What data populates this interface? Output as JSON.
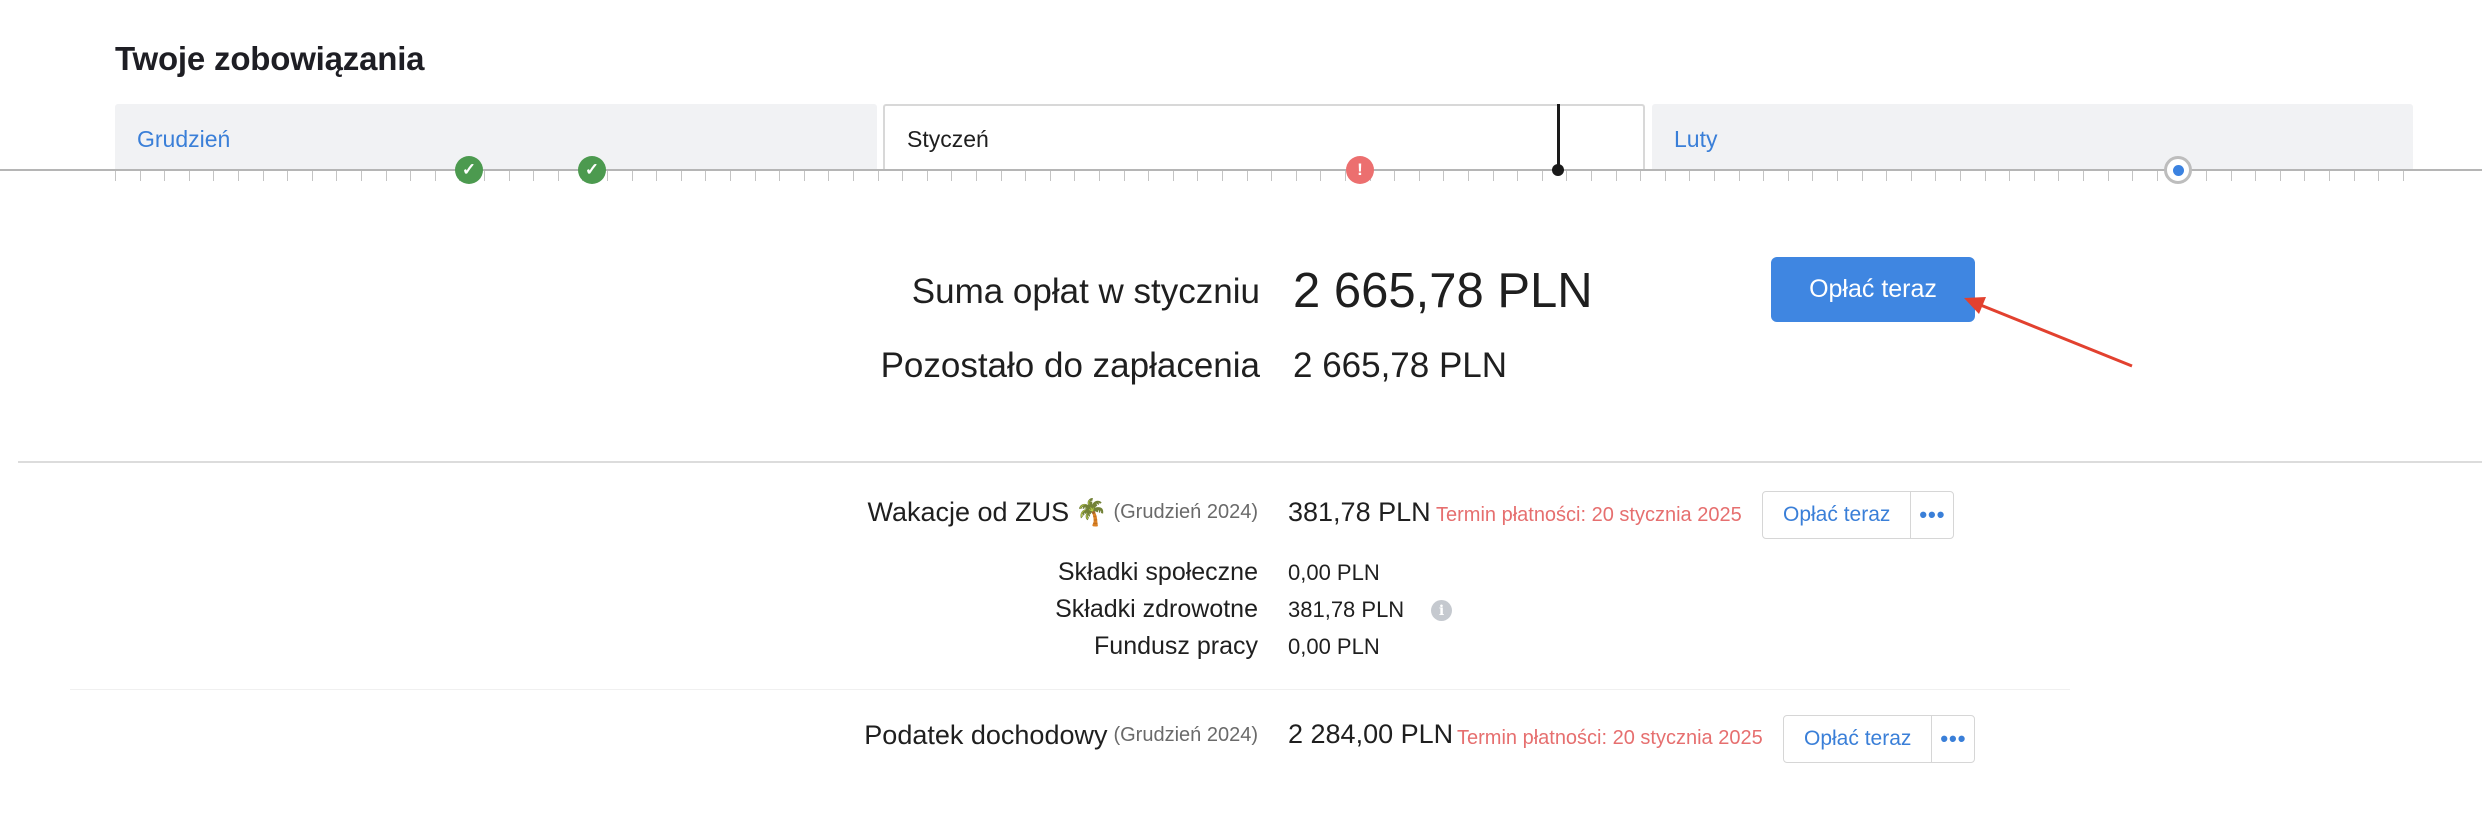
{
  "page": {
    "title": "Twoje zobowiązania"
  },
  "timeline": {
    "months": [
      {
        "label": "Grudzień",
        "active": false
      },
      {
        "label": "Styczeń",
        "active": true
      },
      {
        "label": "Luty",
        "active": false
      }
    ],
    "markers": [
      {
        "status": "paid",
        "icon": "check-icon",
        "glyph": "✓"
      },
      {
        "status": "paid",
        "icon": "check-icon",
        "glyph": "✓"
      },
      {
        "status": "overdue",
        "icon": "exclamation-icon",
        "glyph": "!"
      },
      {
        "status": "upcoming",
        "icon": "dot-icon",
        "glyph": ""
      }
    ],
    "colors": {
      "paid": "#4c9a4f",
      "overdue": "#ec6f6f",
      "upcoming": "#3b82e0",
      "accent": "#3a7fd8"
    }
  },
  "summary": {
    "sum_label": "Suma opłat w styczniu",
    "sum_value": "2 665,78 PLN",
    "remaining_label": "Pozostało do zapłacenia",
    "remaining_value": "2 665,78 PLN",
    "pay_button": "Opłać teraz"
  },
  "obligations": [
    {
      "title": "Wakacje od ZUS",
      "icon": "palm-tree-icon",
      "period": "(Grudzień 2024)",
      "amount": "381,78 PLN",
      "due": "Termin płatności: 20 stycznia 2025",
      "pay_label": "Opłać teraz",
      "more_label": "•••",
      "details": [
        {
          "label": "Składki społeczne",
          "value": "0,00 PLN"
        },
        {
          "label": "Składki zdrowotne",
          "value": "381,78 PLN",
          "info": "i"
        },
        {
          "label": "Fundusz pracy",
          "value": "0,00 PLN"
        }
      ]
    },
    {
      "title": "Podatek dochodowy",
      "period": "(Grudzień 2024)",
      "amount": "2 284,00 PLN",
      "due": "Termin płatności: 20 stycznia 2025",
      "pay_label": "Opłać teraz",
      "more_label": "•••"
    }
  ]
}
